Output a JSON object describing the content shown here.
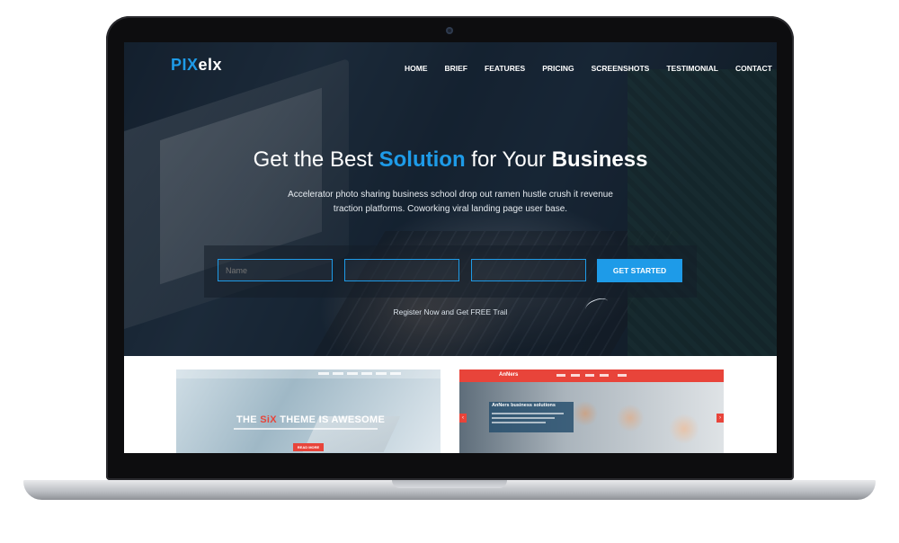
{
  "site": {
    "logo_part1": "PIX",
    "logo_part2": "elx",
    "nav": [
      "HOME",
      "BRIEF",
      "FEATURES",
      "PRICING",
      "SCREENSHOTS",
      "TESTIMONIAL",
      "CONTACT"
    ]
  },
  "hero": {
    "headline_1": "Get the Best ",
    "headline_highlight": "Solution",
    "headline_2": " for Your ",
    "headline_bold": "Business",
    "subtext": "Accelerator photo sharing business school drop out ramen hustle crush it revenue traction platforms. Coworking viral landing page user base.",
    "trial_text": "Register Now and Get FREE Trail"
  },
  "form": {
    "name_placeholder": "Name",
    "field2_placeholder": "",
    "field3_placeholder": "",
    "cta_label": "GET STARTED"
  },
  "thumbnails": {
    "t1": {
      "title_1": "THE ",
      "title_red": "SiX",
      "title_2": " THEME IS AWESOME",
      "button": "READ MORE"
    },
    "t2": {
      "logo": "AnNers",
      "box_title": "AnNers business solutions",
      "prev": "‹",
      "next": "›"
    }
  },
  "colors": {
    "accent": "#1e9be8",
    "red": "#e8443a"
  }
}
